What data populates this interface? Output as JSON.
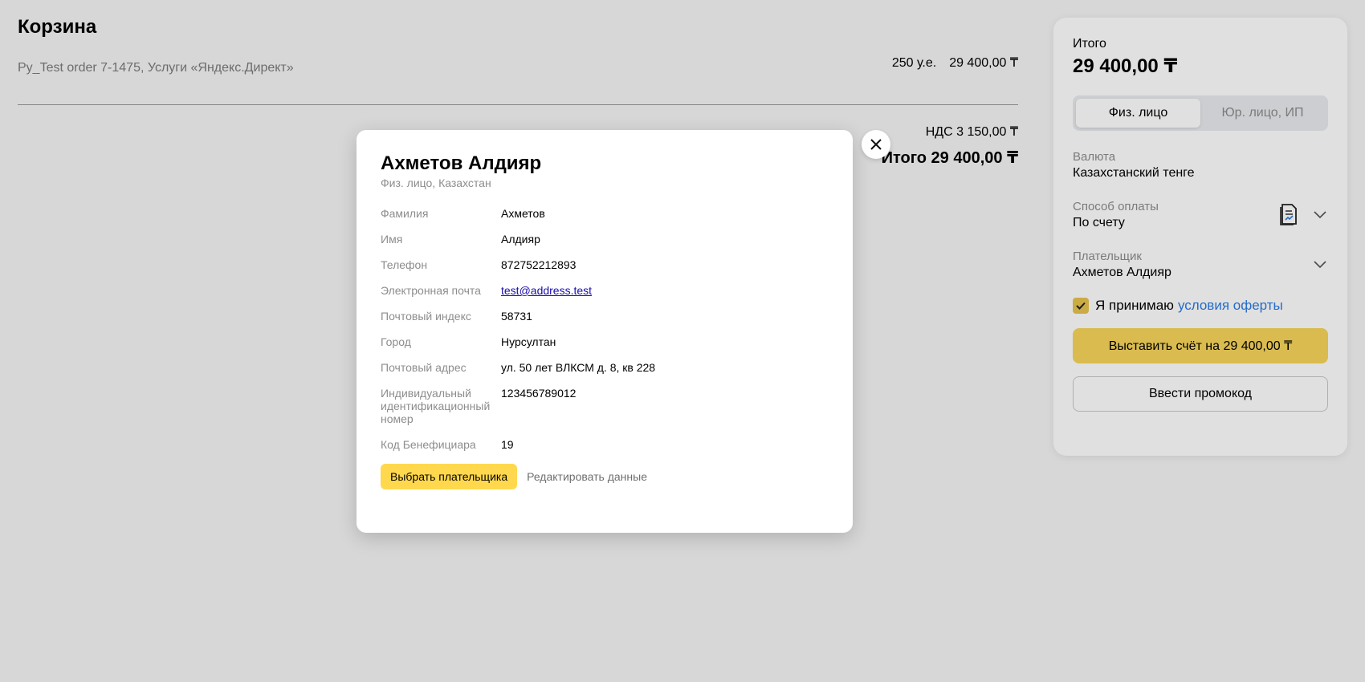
{
  "cart": {
    "title": "Корзина",
    "order_line": "Py_Test order 7-1475, Услуги «Яндекс.Директ»",
    "units": "250 у.е.",
    "price": "29 400,00 ₸",
    "vat": "НДС 3 150,00 ₸",
    "total": "Итого 29 400,00 ₸"
  },
  "summary": {
    "total_label": "Итого",
    "total_amount": "29 400,00 ₸",
    "segments": [
      "Физ. лицо",
      "Юр. лицо, ИП"
    ],
    "active_segment": "Физ. лицо",
    "currency_label": "Валюта",
    "currency_value": "Казахстанский тенге",
    "payment_label": "Способ оплаты",
    "payment_value": "По счету",
    "payer_label": "Плательщик",
    "payer_value": "Ахметов Алдияр",
    "accept_text": "Я принимаю",
    "accept_link": "условия оферты",
    "invoice_button": "Выставить счёт на 29 400,00 ₸",
    "promo_button": "Ввести промокод",
    "accent_color": "#f7d55a",
    "link_color": "#2a7be4"
  },
  "modal": {
    "title": "Ахметов Алдияр",
    "subtitle": "Физ. лицо, Казахстан",
    "rows": [
      {
        "label": "Фамилия",
        "value": "Ахметов"
      },
      {
        "label": "Имя",
        "value": "Алдияр"
      },
      {
        "label": "Телефон",
        "value": "872752212893"
      },
      {
        "label": "Электронная почта",
        "value": "test@address.test"
      },
      {
        "label": "Почтовый индекс",
        "value": "58731"
      },
      {
        "label": "Город",
        "value": "Нурсултан"
      },
      {
        "label": "Почтовый адрес",
        "value": "ул. 50 лет ВЛКСМ д. 8, кв 228"
      },
      {
        "label": "Индивидуальный идентификационный номер",
        "value": "123456789012"
      },
      {
        "label": "Код Бенефициара",
        "value": "19"
      }
    ],
    "select_button": "Выбрать плательщика",
    "edit_link": "Редактировать данные",
    "close_icon": "close-icon"
  }
}
